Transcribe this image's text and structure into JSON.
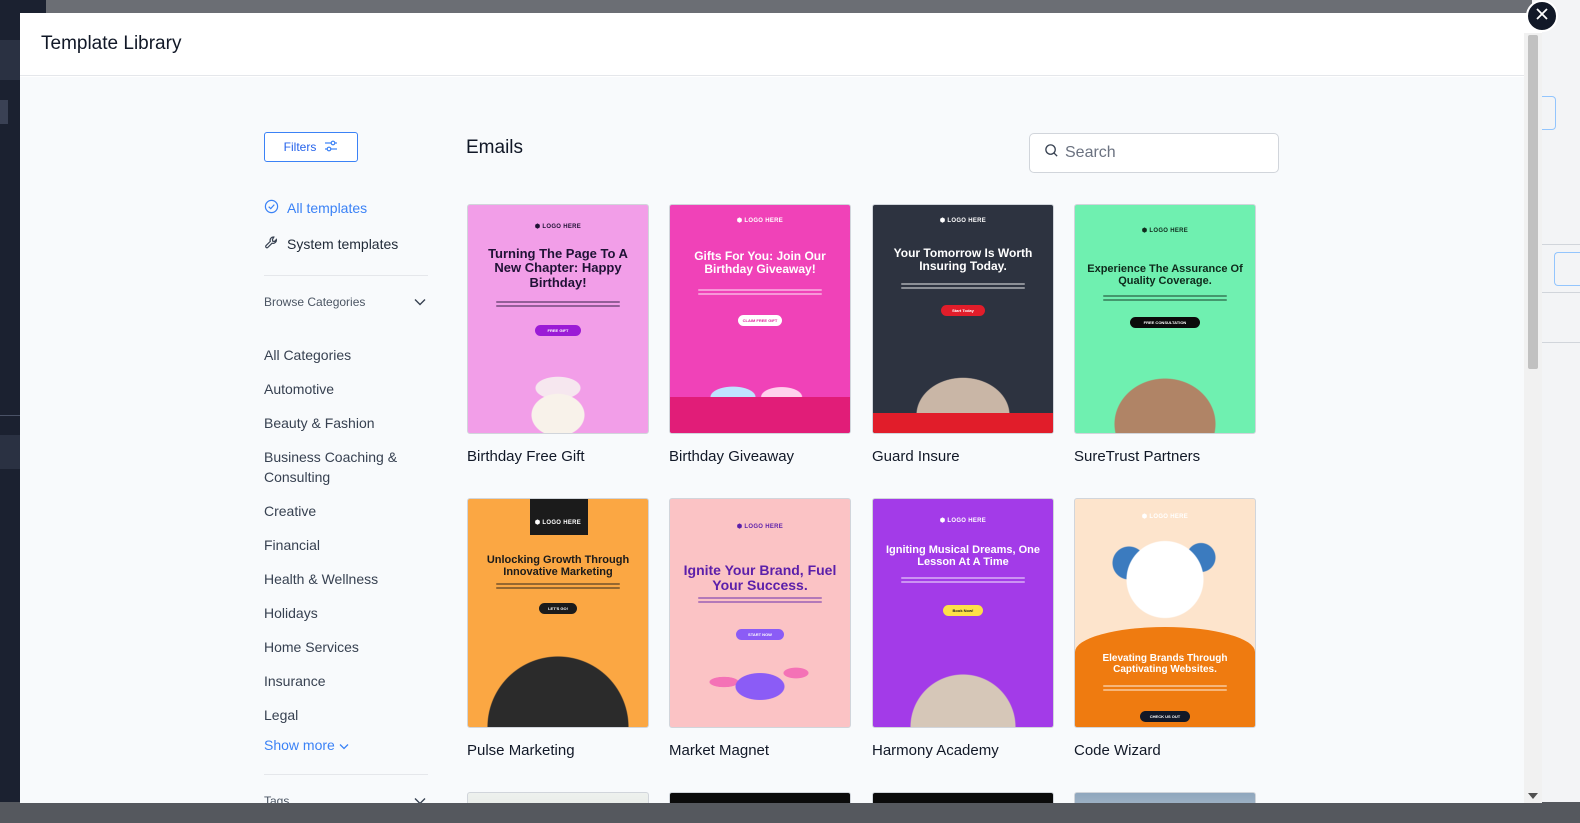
{
  "modal": {
    "title": "Template Library"
  },
  "sidebar": {
    "filters_label": "Filters",
    "nav": [
      {
        "label": "All templates",
        "active": true
      },
      {
        "label": "System templates",
        "active": false
      }
    ],
    "browse_categories_label": "Browse Categories",
    "categories": [
      "All Categories",
      "Automotive",
      "Beauty & Fashion",
      "Business Coaching & Consulting",
      "Creative",
      "Financial",
      "Health & Wellness",
      "Holidays",
      "Home Services",
      "Insurance",
      "Legal"
    ],
    "show_more_label": "Show more",
    "tags_label": "Tags"
  },
  "main": {
    "title": "Emails",
    "search": {
      "placeholder": "Search",
      "value": ""
    },
    "templates": [
      {
        "name": "Birthday Free Gift",
        "logo": "LOGO HERE",
        "headline": "Turning The Page To A New Chapter: Happy Birthday!",
        "button": "FREE GIFT",
        "bg": "#f29ee8",
        "text_color": "#1f1235",
        "btn_bg": "#9b1bd6",
        "btn_color": "#ffffff"
      },
      {
        "name": "Birthday Giveaway",
        "logo": "LOGO HERE",
        "headline": "Gifts For You: Join Our Birthday Giveaway!",
        "button": "CLAIM FREE GIFT",
        "bg": "#f042b8",
        "text_color": "#ffffff",
        "btn_bg": "#ffffff",
        "btn_color": "#e0249b"
      },
      {
        "name": "Guard Insure",
        "logo": "LOGO HERE",
        "headline": "Your Tomorrow Is Worth Insuring Today.",
        "button": "Start Today",
        "bg": "#2d3340",
        "text_color": "#ffffff",
        "btn_bg": "#e11d2a",
        "btn_color": "#ffffff"
      },
      {
        "name": "SureTrust Partners",
        "logo": "LOGO HERE",
        "headline": "Experience The Assurance Of Quality Coverage.",
        "button": "FREE CONSULTATION",
        "bg": "#6ff0b0",
        "text_color": "#0f2a1c",
        "btn_bg": "#0b0b0b",
        "btn_color": "#ffffff"
      },
      {
        "name": "Pulse Marketing",
        "logo": "LOGO HERE",
        "headline": "Unlocking Growth Through Innovative Marketing",
        "button": "LET'S GO!",
        "bg": "#fba743",
        "text_color": "#1b1b1b",
        "btn_bg": "#1b1b1b",
        "btn_color": "#ffffff"
      },
      {
        "name": "Market Magnet",
        "logo": "LOGO HERE",
        "headline": "Ignite Your Brand, Fuel Your Success.",
        "button": "START NOW",
        "bg": "#fbc3c5",
        "text_color": "#5b1faa",
        "btn_bg": "#8b5cf6",
        "btn_color": "#ffffff"
      },
      {
        "name": "Harmony Academy",
        "logo": "LOGO HERE",
        "headline": "Igniting Musical Dreams, One Lesson At A Time",
        "button": "Book Now!",
        "bg": "#a33be8",
        "text_color": "#ffffff",
        "btn_bg": "#fde047",
        "btn_color": "#1b1b1b"
      },
      {
        "name": "Code Wizard",
        "logo": "LOGO HERE",
        "headline": "Elevating Brands Through Captivating Websites.",
        "button": "CHECK US OUT",
        "bg": "#fde4cc",
        "text_color": "#ffffff",
        "btn_bg": "#111827",
        "btn_color": "#ffffff"
      }
    ]
  },
  "icons": {
    "close": "close-icon",
    "filters": "sliders-icon",
    "all_templates": "check-circle-icon",
    "system_templates": "wrench-icon",
    "search": "search-icon",
    "chevron": "chevron-down-icon"
  }
}
